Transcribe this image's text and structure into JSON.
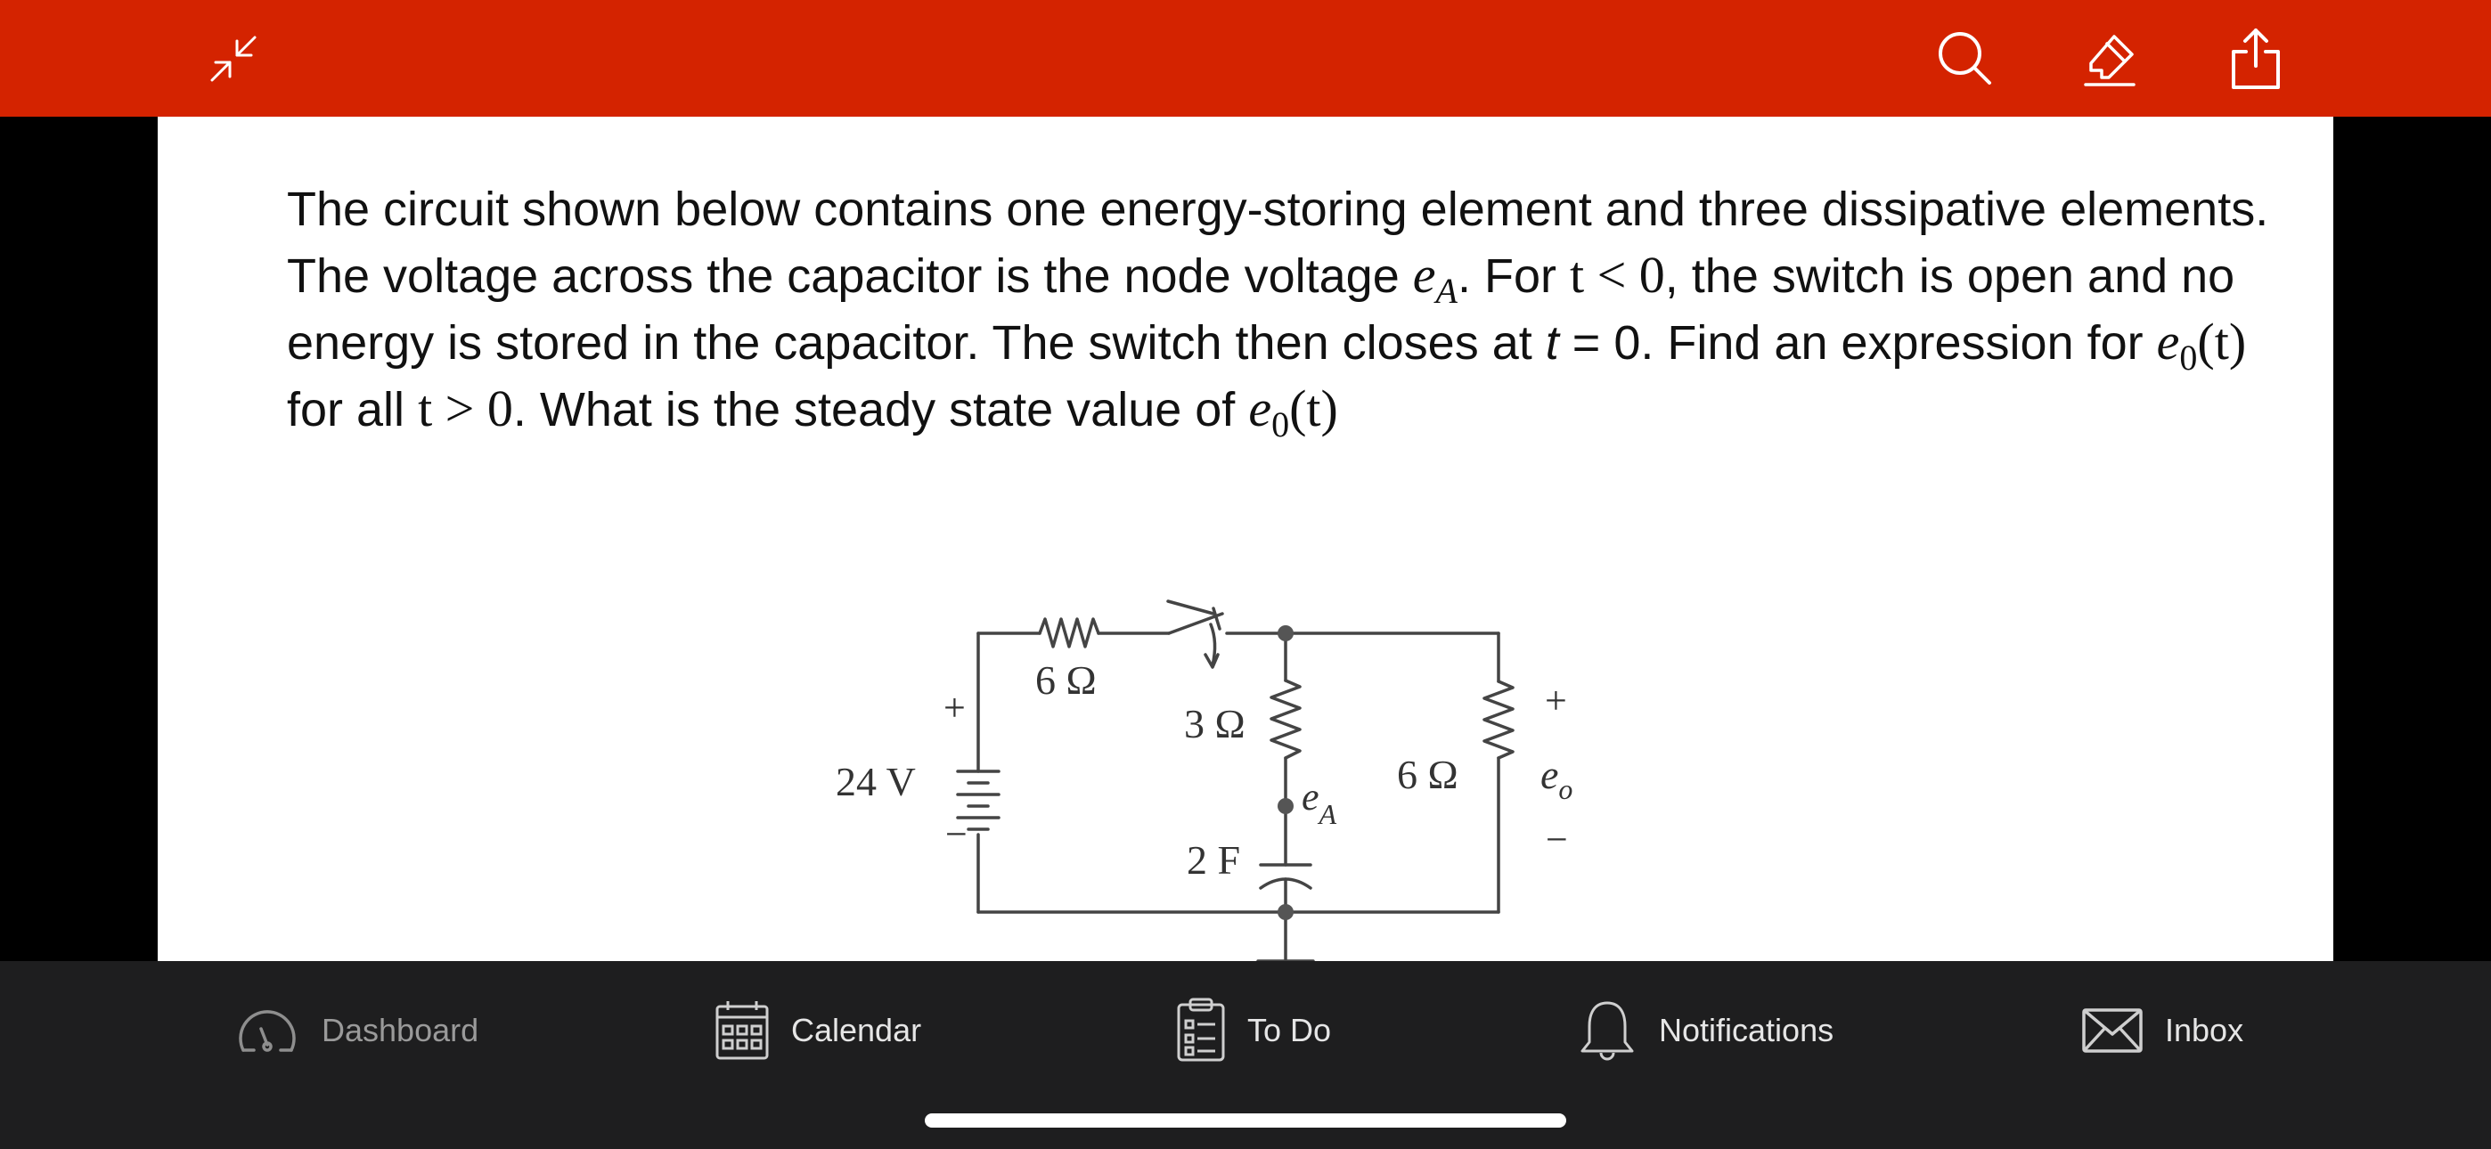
{
  "colors": {
    "topbar": "#d42300",
    "tabbar": "#1e1e1f",
    "page": "#ffffff",
    "letterbox": "#000000"
  },
  "toolbar": {
    "icons": [
      "collapse-fullscreen-icon",
      "search-icon",
      "highlighter-icon",
      "share-icon"
    ]
  },
  "question": {
    "p1": "The circuit shown below contains one energy-storing element and three dissipative elements. The voltage across the capacitor is the node voltage ",
    "eA_base": "e",
    "eA_sub": "A",
    "p2": ". For ",
    "m1": "t < 0",
    "p3": ", the switch is open and no energy is stored in the capacitor. The switch then closes at ",
    "t0": "t",
    "p4": " = 0. Find an expression for ",
    "e0_base": "e",
    "e0_sub": "0",
    "e0_arg": "(t)",
    "p5": " for all ",
    "m2": "t > 0",
    "p6": ". What is the steady state value of ",
    "e0b_base": "e",
    "e0b_sub": "0",
    "e0b_arg": "(t)"
  },
  "circuit": {
    "source_label": "24 V",
    "source_plus": "+",
    "source_minus": "−",
    "r1_label": "6 Ω",
    "r2_label": "3 Ω",
    "r3_label": "6 Ω",
    "cap_label": "2 F",
    "node_label_base": "e",
    "node_label_sub": "A",
    "out_plus": "+",
    "out_label": "e",
    "out_sub": "o",
    "out_minus": "−"
  },
  "tabs": [
    {
      "label": "Dashboard",
      "icon": "dashboard-icon"
    },
    {
      "label": "Calendar",
      "icon": "calendar-icon"
    },
    {
      "label": "To Do",
      "icon": "todo-icon"
    },
    {
      "label": "Notifications",
      "icon": "bell-icon"
    },
    {
      "label": "Inbox",
      "icon": "inbox-icon"
    }
  ]
}
